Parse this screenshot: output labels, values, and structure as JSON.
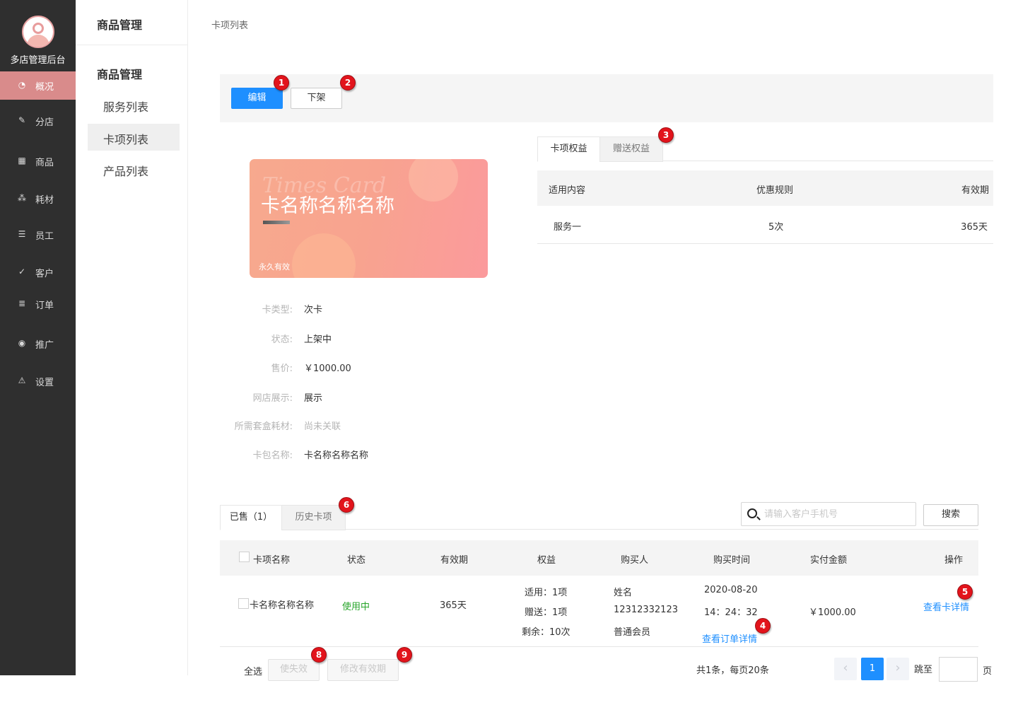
{
  "app": {
    "title": "多店管理后台"
  },
  "sidebar": {
    "items": [
      {
        "label": "概况",
        "icon": "dashboard-icon",
        "active": true
      },
      {
        "label": "分店",
        "icon": "edit-icon"
      },
      {
        "label": "商品",
        "icon": "grid-icon"
      },
      {
        "label": "耗材",
        "icon": "cubes-icon"
      },
      {
        "label": "员工",
        "icon": "list-icon"
      },
      {
        "label": "客户",
        "icon": "check-circle-icon"
      },
      {
        "label": "订单",
        "icon": "document-icon"
      },
      {
        "label": "推广",
        "icon": "chart-icon"
      },
      {
        "label": "设置",
        "icon": "warning-icon"
      }
    ]
  },
  "subnav": {
    "header": "商品管理",
    "group": "商品管理",
    "items": [
      {
        "label": "服务列表"
      },
      {
        "label": "卡项列表",
        "active": true
      },
      {
        "label": "产品列表"
      }
    ]
  },
  "breadcrumb": "卡项列表",
  "toolbar": {
    "edit_label": "编辑",
    "offshelf_label": "下架"
  },
  "annotations": [
    "1",
    "2",
    "3",
    "4",
    "5",
    "6",
    "8",
    "9"
  ],
  "card": {
    "watermark": "Times Card",
    "name": "卡名称名称名称",
    "validity": "永久有效"
  },
  "info": {
    "card_type_label": "卡类型:",
    "card_type": "次卡",
    "status_label": "状态:",
    "status": "上架中",
    "price_label": "售价:",
    "price": "￥1000.00",
    "shop_display_label": "网店展示:",
    "shop_display": "展示",
    "consumables_label": "所需套盒耗材:",
    "consumables": "尚未关联",
    "cardbag_label": "卡包名称:",
    "cardbag": "卡名称名称名称"
  },
  "rights": {
    "tabs": [
      "卡项权益",
      "赠送权益"
    ],
    "columns": [
      "适用内容",
      "优惠规则",
      "有效期"
    ],
    "rows": [
      {
        "content": "服务一",
        "rule": "5次",
        "validity": "365天"
      }
    ]
  },
  "sold": {
    "tabs": [
      "已售（1）",
      "历史卡项"
    ],
    "search_placeholder": "请输入客户手机号",
    "search_button": "搜索",
    "columns": [
      "卡项名称",
      "状态",
      "有效期",
      "权益",
      "购买人",
      "购买时间",
      "实付金额",
      "操作"
    ],
    "rows": [
      {
        "name": "卡名称名称名称",
        "status": "使用中",
        "validity": "365天",
        "rights": [
          "适用：1项",
          "赠送：1项",
          "剩余：10次"
        ],
        "buyer": [
          "姓名",
          "12312332123",
          "普通会员"
        ],
        "time": [
          "2020-08-20",
          "14：24：32"
        ],
        "order_link": "查看订单详情",
        "amount": "￥1000.00",
        "action": "查看卡详情"
      }
    ]
  },
  "footer": {
    "select_all": "全选",
    "invalidate": "使失效",
    "modify_validity": "修改有效期",
    "summary": "共1条，每页20条",
    "current_page": "1",
    "jump_to": "跳至",
    "page_unit": "页"
  },
  "colors": {
    "primary": "#1e8fff",
    "sidebar": "#2f2f2f",
    "active_nav": "#d98b8b",
    "badge": "#e2141c",
    "status_green": "#27a52a"
  }
}
